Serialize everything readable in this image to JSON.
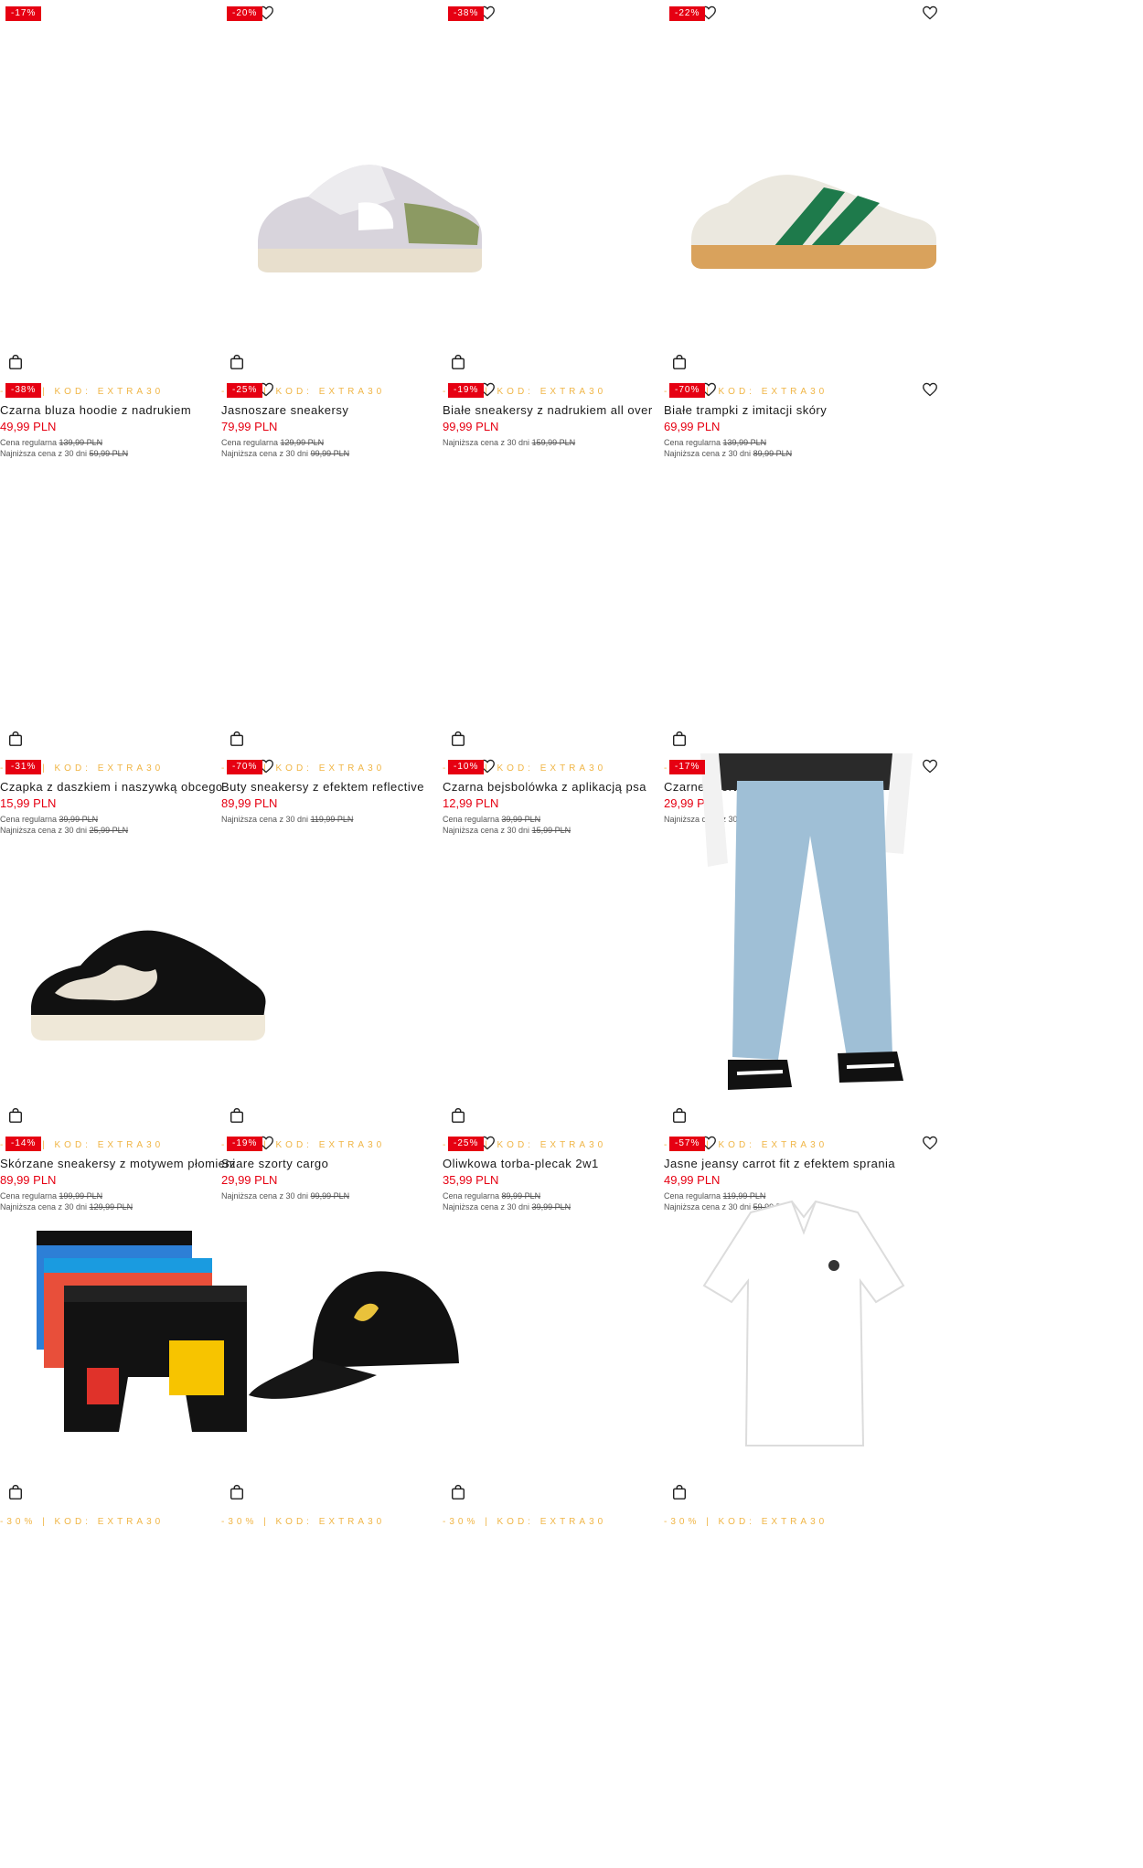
{
  "colors": {
    "accent": "#e60012",
    "promo": "#f0b545"
  },
  "icons": {
    "wishlist": "heart-icon",
    "cart": "shopping-bag-icon"
  },
  "products": [
    {
      "discount": "-17%",
      "promo": "-30% | KOD: EXTRA30",
      "name": "Czarna bluza hoodie z nadrukiem",
      "price": "49,99 PLN",
      "regular_label": "Cena regularna",
      "regular": "139,99 PLN",
      "lowest_label": "Najniższa cena z 30 dni",
      "lowest": "59,99 PLN",
      "image": "none"
    },
    {
      "discount": "-20%",
      "promo": "-30% | KOD: EXTRA30",
      "name": "Jasnoszare sneakersy",
      "price": "79,99 PLN",
      "regular_label": "Cena regularna",
      "regular": "129,99 PLN",
      "lowest_label": "Najniższa cena z 30 dni",
      "lowest": "99,99 PLN",
      "image": "sneaker-grey"
    },
    {
      "discount": "-38%",
      "promo": "-30% | KOD: EXTRA30",
      "name": "Białe sneakersy z nadrukiem all over",
      "price": "99,99 PLN",
      "regular_label": "",
      "regular": "",
      "lowest_label": "Najniższa cena z 30 dni",
      "lowest": "159,99 PLN",
      "image": "none"
    },
    {
      "discount": "-22%",
      "promo": "-30% | KOD: EXTRA30",
      "name": "Białe trampki z imitacji skóry",
      "price": "69,99 PLN",
      "regular_label": "Cena regularna",
      "regular": "139,99 PLN",
      "lowest_label": "Najniższa cena z 30 dni",
      "lowest": "89,99 PLN",
      "image": "sneaker-green"
    },
    {
      "discount": "-38%",
      "promo": "-30% | KOD: EXTRA30",
      "name": "Czapka z daszkiem i naszywką obcego",
      "price": "15,99 PLN",
      "regular_label": "Cena regularna",
      "regular": "39,99 PLN",
      "lowest_label": "Najniższa cena z 30 dni",
      "lowest": "25,99 PLN",
      "image": "none"
    },
    {
      "discount": "-25%",
      "promo": "-30% | KOD: EXTRA30",
      "name": "Buty sneakersy z efektem reflective",
      "price": "89,99 PLN",
      "regular_label": "",
      "regular": "",
      "lowest_label": "Najniższa cena z 30 dni",
      "lowest": "119,99 PLN",
      "image": "none"
    },
    {
      "discount": "-19%",
      "promo": "-30% | KOD: EXTRA30",
      "name": "Czarna bejsbolówka z aplikacją psa",
      "price": "12,99 PLN",
      "regular_label": "Cena regularna",
      "regular": "39,99 PLN",
      "lowest_label": "Najniższa cena z 30 dni",
      "lowest": "15,99 PLN",
      "image": "none"
    },
    {
      "discount": "-70%",
      "promo": "-30% | KOD: EXTRA30",
      "name": "Czarne szorty z paskiem",
      "price": "29,99 PLN",
      "regular_label": "",
      "regular": "",
      "lowest_label": "Najniższa cena z 30 dni",
      "lowest": "99,99 PLN",
      "image": "none"
    },
    {
      "discount": "-31%",
      "promo": "-30% | KOD: EXTRA30",
      "name": "Skórzane sneakersy z motywem płomieni",
      "price": "89,99 PLN",
      "regular_label": "Cena regularna",
      "regular": "199,99 PLN",
      "lowest_label": "Najniższa cena z 30 dni",
      "lowest": "129,99 PLN",
      "image": "sneaker-flame"
    },
    {
      "discount": "-70%",
      "promo": "-30% | KOD: EXTRA30",
      "name": "Szare szorty cargo",
      "price": "29,99 PLN",
      "regular_label": "",
      "regular": "",
      "lowest_label": "Najniższa cena z 30 dni",
      "lowest": "99,99 PLN",
      "image": "none"
    },
    {
      "discount": "-10%",
      "promo": "-30% | KOD: EXTRA30",
      "name": "Oliwkowa torba-plecak 2w1",
      "price": "35,99 PLN",
      "regular_label": "Cena regularna",
      "regular": "89,99 PLN",
      "lowest_label": "Najniższa cena z 30 dni",
      "lowest": "39,99 PLN",
      "image": "none"
    },
    {
      "discount": "-17%",
      "promo": "-30% | KOD: EXTRA30",
      "name": "Jasne jeansy carrot fit z efektem sprania",
      "price": "49,99 PLN",
      "regular_label": "Cena regularna",
      "regular": "119,99 PLN",
      "lowest_label": "Najniższa cena z 30 dni",
      "lowest": "59,99 PLN",
      "image": "jeans"
    },
    {
      "discount": "-14%",
      "promo": "-30% | KOD: EXTRA30",
      "name": "",
      "price": "",
      "regular_label": "",
      "regular": "",
      "lowest_label": "",
      "lowest": "",
      "image": "boxers"
    },
    {
      "discount": "-19%",
      "promo": "-30% | KOD: EXTRA30",
      "name": "",
      "price": "",
      "regular_label": "",
      "regular": "",
      "lowest_label": "",
      "lowest": "",
      "image": "cap"
    },
    {
      "discount": "-25%",
      "promo": "-30% | KOD: EXTRA30",
      "name": "",
      "price": "",
      "regular_label": "",
      "regular": "",
      "lowest_label": "",
      "lowest": "",
      "image": "none"
    },
    {
      "discount": "-57%",
      "promo": "-30% | KOD: EXTRA30",
      "name": "",
      "price": "",
      "regular_label": "",
      "regular": "",
      "lowest_label": "",
      "lowest": "",
      "image": "polo"
    }
  ]
}
